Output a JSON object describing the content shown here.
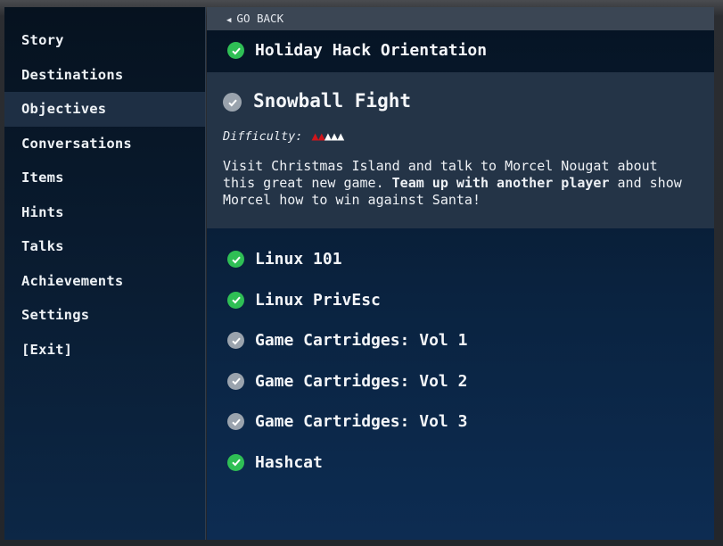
{
  "sidebar": {
    "items": [
      {
        "label": "Story",
        "active": false
      },
      {
        "label": "Destinations",
        "active": false
      },
      {
        "label": "Objectives",
        "active": true
      },
      {
        "label": "Conversations",
        "active": false
      },
      {
        "label": "Items",
        "active": false
      },
      {
        "label": "Hints",
        "active": false
      },
      {
        "label": "Talks",
        "active": false
      },
      {
        "label": "Achievements",
        "active": false
      },
      {
        "label": "Settings",
        "active": false
      },
      {
        "label": "[Exit]",
        "active": false
      }
    ]
  },
  "header": {
    "go_back": "GO BACK",
    "go_back_icon": "triangle-left-icon"
  },
  "objectives": [
    {
      "title": "Holiday Hack Orientation",
      "status": "complete"
    }
  ],
  "selected": {
    "title": "Snowball Fight",
    "status": "incomplete",
    "difficulty_label": "Difficulty:",
    "difficulty": {
      "level": 2,
      "max": 5,
      "icon": "tree-icon",
      "on_color": "#d0161c",
      "off_color": "#ffffff"
    },
    "desc_part1": "Visit Christmas Island and talk to Morcel Nougat about this great new game. ",
    "desc_bold": "Team up with another player",
    "desc_part2": " and show Morcel how to win against Santa!"
  },
  "objectives_after": [
    {
      "title": "Linux 101",
      "status": "complete"
    },
    {
      "title": "Linux PrivEsc",
      "status": "complete"
    },
    {
      "title": "Game Cartridges: Vol 1",
      "status": "incomplete"
    },
    {
      "title": "Game Cartridges: Vol 2",
      "status": "incomplete"
    },
    {
      "title": "Game Cartridges: Vol 3",
      "status": "incomplete"
    },
    {
      "title": "Hashcat",
      "status": "complete"
    }
  ],
  "colors": {
    "complete": "#2fbf55",
    "incomplete": "#9aa3ad",
    "accent_tree": "#d0161c"
  }
}
